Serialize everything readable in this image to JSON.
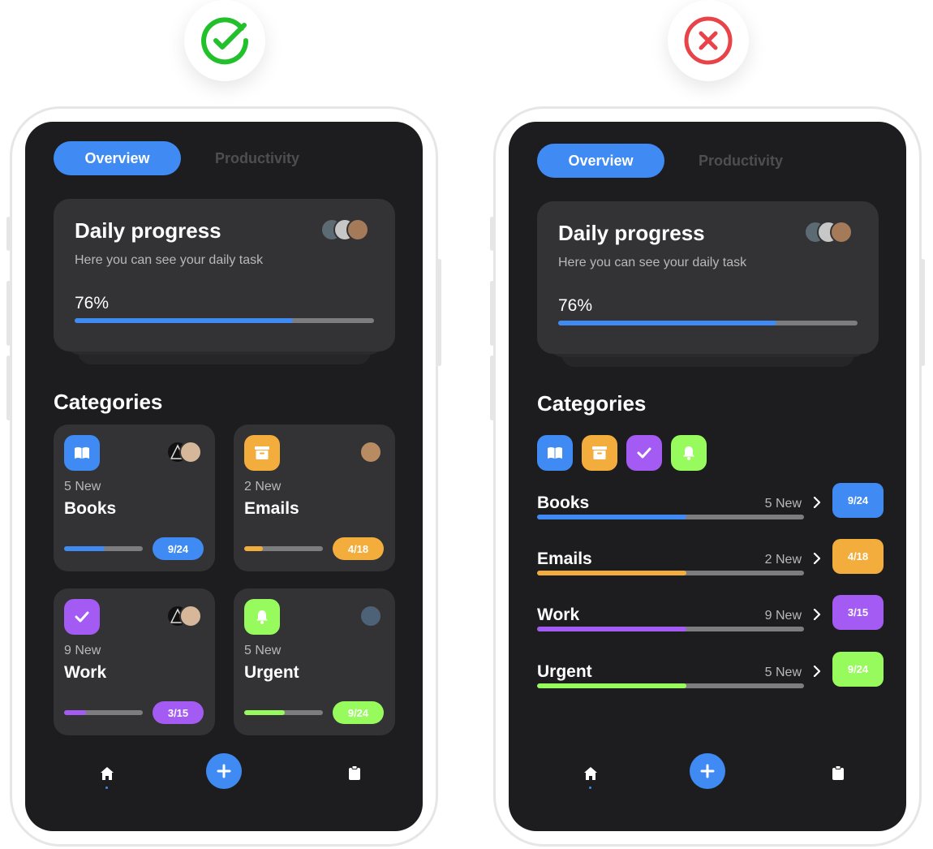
{
  "verdicts": {
    "good_icon": "check-circle-icon",
    "bad_icon": "x-circle-icon",
    "good_color": "#22c02b",
    "bad_color": "#e9434a"
  },
  "colors": {
    "blue": "#3f8bf3",
    "orange": "#f3ad3c",
    "purple": "#a45bf3",
    "green": "#98fb5d",
    "screen_bg": "#1d1d1f",
    "card_bg": "#333335"
  },
  "tabs": {
    "active": "Overview",
    "inactive": "Productivity"
  },
  "daily_progress": {
    "title": "Daily progress",
    "subtitle": "Here you can see your daily task",
    "percent_label": "76%",
    "progress": 0.73
  },
  "categories_title": "Categories",
  "categories": [
    {
      "name": "Books",
      "new_label": "5 New",
      "count": "9/24",
      "progress": 0.52,
      "color": "#3f8bf3",
      "icon": "book-icon"
    },
    {
      "name": "Emails",
      "new_label": "2 New",
      "count": "4/18",
      "progress": 0.24,
      "color": "#f3ad3c",
      "icon": "archive-icon"
    },
    {
      "name": "Work",
      "new_label": "9 New",
      "count": "3/15",
      "progress": 0.28,
      "color": "#a45bf3",
      "icon": "check-icon"
    },
    {
      "name": "Urgent",
      "new_label": "5 New",
      "count": "9/24",
      "progress": 0.52,
      "color": "#98fb5d",
      "icon": "bell-icon"
    }
  ],
  "list_progress": [
    0.56,
    0.56,
    0.56,
    0.56
  ],
  "nav": {
    "home": "home-icon",
    "add": "plus-icon",
    "tasks": "clipboard-icon"
  }
}
